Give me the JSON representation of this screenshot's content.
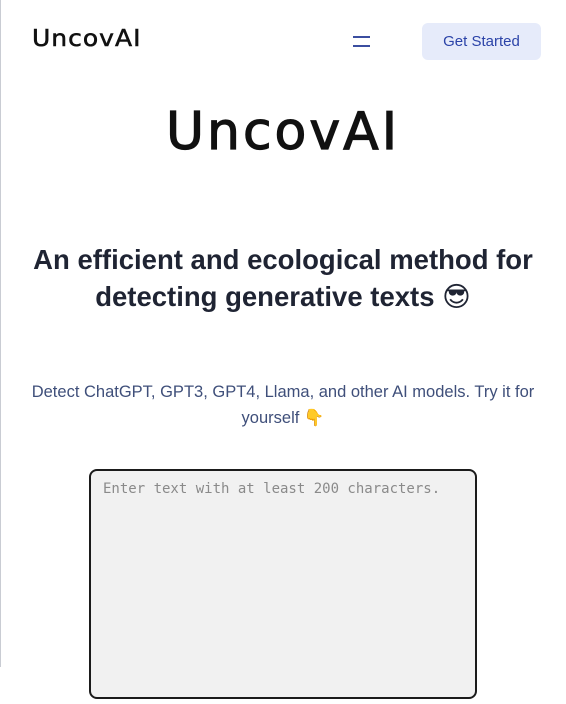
{
  "header": {
    "logo_text": "UncovAI",
    "menu_icon": "hamburger-menu-icon",
    "cta_label": "Get Started"
  },
  "hero": {
    "logo_text": "UncovAI",
    "headline": "An efficient and ecological method for detecting generative texts 😎",
    "subtitle": "Detect ChatGPT, GPT3, GPT4, Llama, and other AI models. Try it for yourself 👇"
  },
  "input": {
    "placeholder": "Enter text with at least 200 characters.",
    "value": ""
  },
  "colors": {
    "cta_bg": "#e6ebfa",
    "cta_text": "#2b43a8",
    "subtitle_text": "#3f4f7a",
    "textarea_bg": "#f1f1f1"
  }
}
